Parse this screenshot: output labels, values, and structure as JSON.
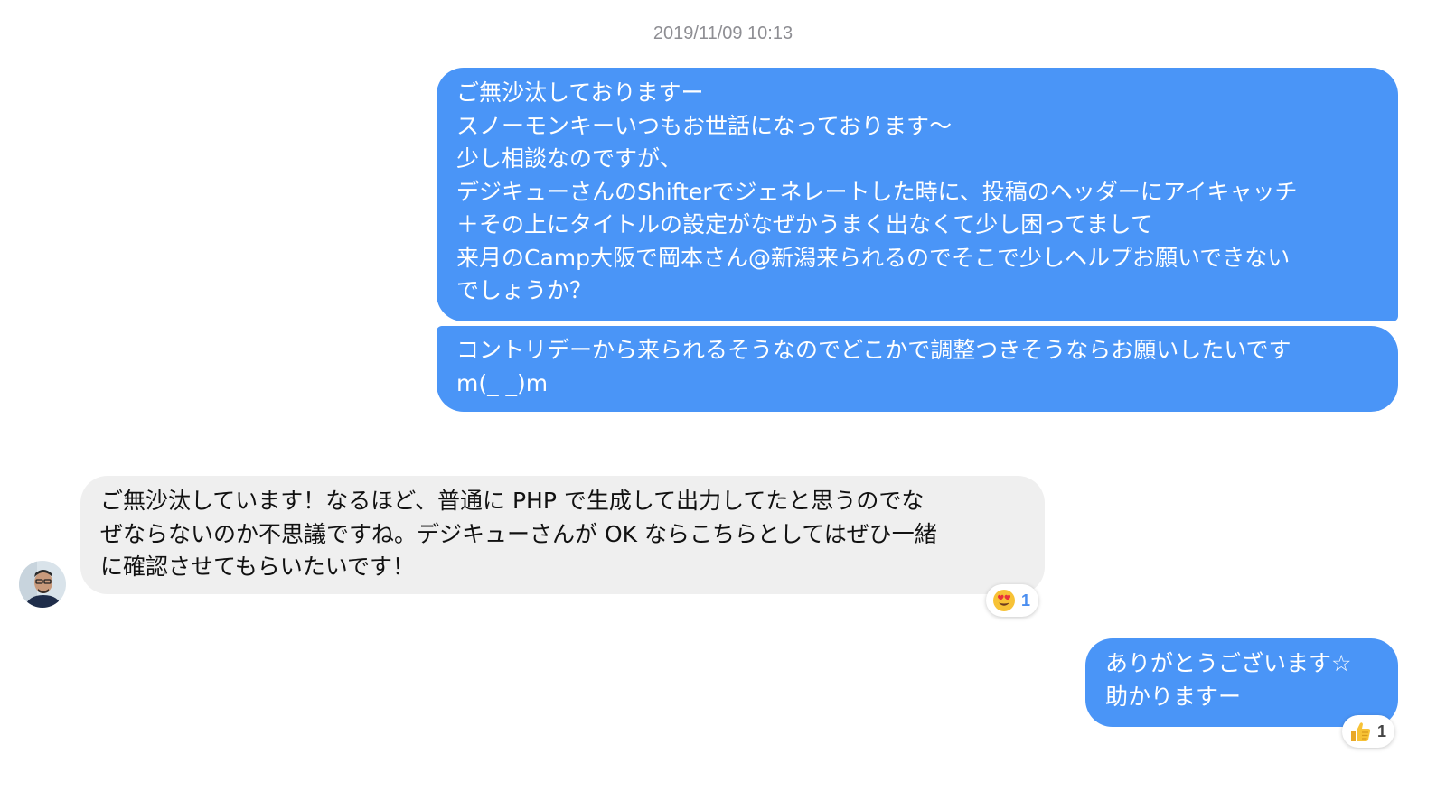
{
  "timestamp": "2019/11/09 10:13",
  "messages": [
    {
      "direction": "outgoing",
      "text": "ご無沙汰しておりますー\nスノーモンキーいつもお世話になっております〜\n少し相談なのですが、\nデジキューさんのShifterでジェネレートした時に、投稿のヘッダーにアイキャッチ\n＋その上にタイトルの設定がなぜかうまく出なくて少し困ってまして\n来月のCamp大阪で岡本さん@新潟来られるのでそこで少しヘルプお願いできない\nでしょうか？"
    },
    {
      "direction": "outgoing",
      "text": "コントリデーから来られるそうなのでどこかで調整つきそうならお願いしたいです\nm(_ _)m"
    },
    {
      "direction": "incoming",
      "text": "ご無沙汰しています！なるほど、普通に PHP で生成して出力してたと思うのでな\nぜならないのか不思議ですね。デジキューさんが OK ならこちらとしてはぜひ一緒\nに確認させてもらいたいです！",
      "reaction": {
        "icon": "heart-eyes-emoji-icon",
        "count": "1"
      }
    },
    {
      "direction": "outgoing",
      "text": "ありがとうございます☆\n助かりますー",
      "reaction": {
        "icon": "thumbs-up-emoji-icon",
        "count": "1"
      }
    }
  ],
  "colors": {
    "outgoing_bubble": "#4a95f7",
    "incoming_bubble": "#efefef",
    "timestamp": "#8e8e93"
  }
}
